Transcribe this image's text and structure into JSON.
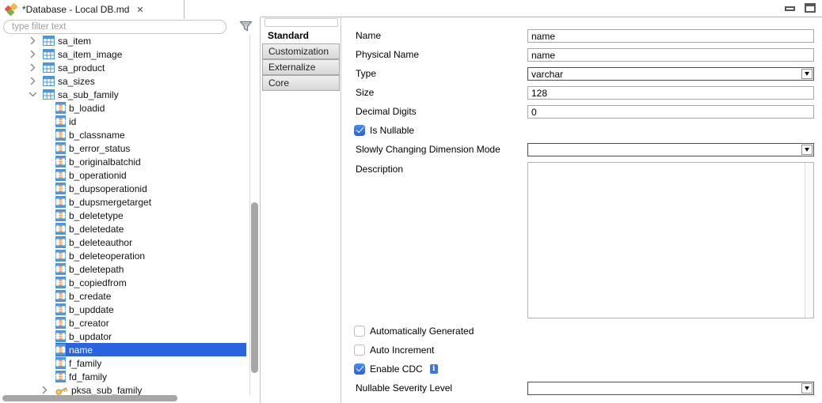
{
  "window": {
    "tab_title": "*Database - Local DB.md",
    "close_glyph": "✕"
  },
  "left_panel": {
    "filter_placeholder": "type filter text",
    "tree_items": [
      {
        "label": "sa_item",
        "type": "table",
        "level": 1,
        "state": "collapsed"
      },
      {
        "label": "sa_item_image",
        "type": "table",
        "level": 1,
        "state": "collapsed"
      },
      {
        "label": "sa_product",
        "type": "table",
        "level": 1,
        "state": "collapsed"
      },
      {
        "label": "sa_sizes",
        "type": "table",
        "level": 1,
        "state": "collapsed"
      },
      {
        "label": "sa_sub_family",
        "type": "table",
        "level": 1,
        "state": "expanded"
      },
      {
        "label": "b_loadid",
        "type": "column",
        "level": 2
      },
      {
        "label": "id",
        "type": "column",
        "level": 2
      },
      {
        "label": "b_classname",
        "type": "column",
        "level": 2
      },
      {
        "label": "b_error_status",
        "type": "column",
        "level": 2
      },
      {
        "label": "b_originalbatchid",
        "type": "column",
        "level": 2
      },
      {
        "label": "b_operationid",
        "type": "column",
        "level": 2
      },
      {
        "label": "b_dupsoperationid",
        "type": "column",
        "level": 2
      },
      {
        "label": "b_dupsmergetarget",
        "type": "column",
        "level": 2
      },
      {
        "label": "b_deletetype",
        "type": "column",
        "level": 2
      },
      {
        "label": "b_deletedate",
        "type": "column",
        "level": 2
      },
      {
        "label": "b_deleteauthor",
        "type": "column",
        "level": 2
      },
      {
        "label": "b_deleteoperation",
        "type": "column",
        "level": 2
      },
      {
        "label": "b_deletepath",
        "type": "column",
        "level": 2
      },
      {
        "label": "b_copiedfrom",
        "type": "column",
        "level": 2
      },
      {
        "label": "b_credate",
        "type": "column",
        "level": 2
      },
      {
        "label": "b_upddate",
        "type": "column",
        "level": 2
      },
      {
        "label": "b_creator",
        "type": "column",
        "level": 2
      },
      {
        "label": "b_updator",
        "type": "column",
        "level": 2
      },
      {
        "label": "name",
        "type": "column",
        "level": 2,
        "selected": true
      },
      {
        "label": "f_family",
        "type": "column",
        "level": 2
      },
      {
        "label": "fd_family",
        "type": "column",
        "level": 2
      },
      {
        "label": "pksa_sub_family",
        "type": "key",
        "level": 2,
        "state": "collapsed"
      }
    ]
  },
  "right_panel": {
    "tabs": [
      {
        "label": "Standard",
        "selected": true
      },
      {
        "label": "Customization",
        "selected": false
      },
      {
        "label": "Externalize",
        "selected": false
      },
      {
        "label": "Core",
        "selected": false
      }
    ],
    "fields": {
      "name": {
        "label": "Name",
        "value": "name"
      },
      "physical_name": {
        "label": "Physical Name",
        "value": "name"
      },
      "type": {
        "label": "Type",
        "value": "varchar"
      },
      "size": {
        "label": "Size",
        "value": "128"
      },
      "decimal_digits": {
        "label": "Decimal Digits",
        "value": "0"
      },
      "is_nullable": {
        "label": "Is Nullable",
        "checked": true
      },
      "scd_mode": {
        "label": "Slowly Changing Dimension Mode",
        "value": ""
      },
      "description": {
        "label": "Description",
        "value": ""
      },
      "auto_generated": {
        "label": "Automatically Generated",
        "checked": false
      },
      "auto_increment": {
        "label": "Auto Increment",
        "checked": false
      },
      "enable_cdc": {
        "label": "Enable CDC",
        "checked": true,
        "info_glyph": "i"
      },
      "nullable_severity": {
        "label": "Nullable Severity Level",
        "value": ""
      }
    }
  },
  "colors": {
    "selection_blue": "#2a63df",
    "icon_blue": "#4e95da",
    "icon_orange": "#f4a653",
    "key_gold": "#d99a2b",
    "checkbox_blue": "#2e6fe3"
  }
}
